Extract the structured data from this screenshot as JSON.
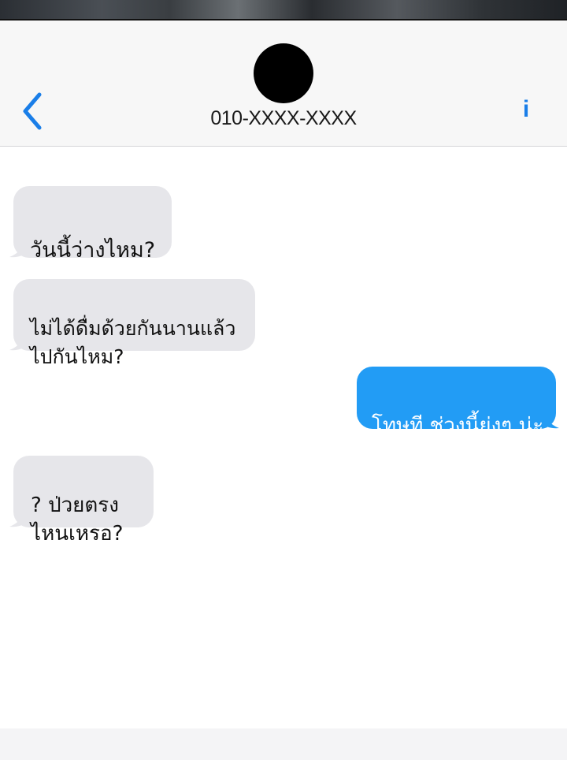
{
  "header": {
    "contact": "010-XXXX-XXXX",
    "back_icon": "chevron-left-icon",
    "info_label": "i"
  },
  "colors": {
    "incoming_bubble": "#e6e6ea",
    "outgoing_bubble": "#229cf5",
    "accent": "#1a7ee8"
  },
  "messages": [
    {
      "direction": "incoming",
      "text": "วันนี้ว่างไหม?"
    },
    {
      "direction": "incoming",
      "text": "ไม่ได้ดื่มด้วยกันนานแล้ว\nไปกันไหม?"
    },
    {
      "direction": "outgoing",
      "text": "โทษที ช่วงนี้ยุ่งๆ น่ะ"
    },
    {
      "direction": "incoming",
      "text": "? ป่วยตรง\nไหนเหรอ?"
    }
  ]
}
